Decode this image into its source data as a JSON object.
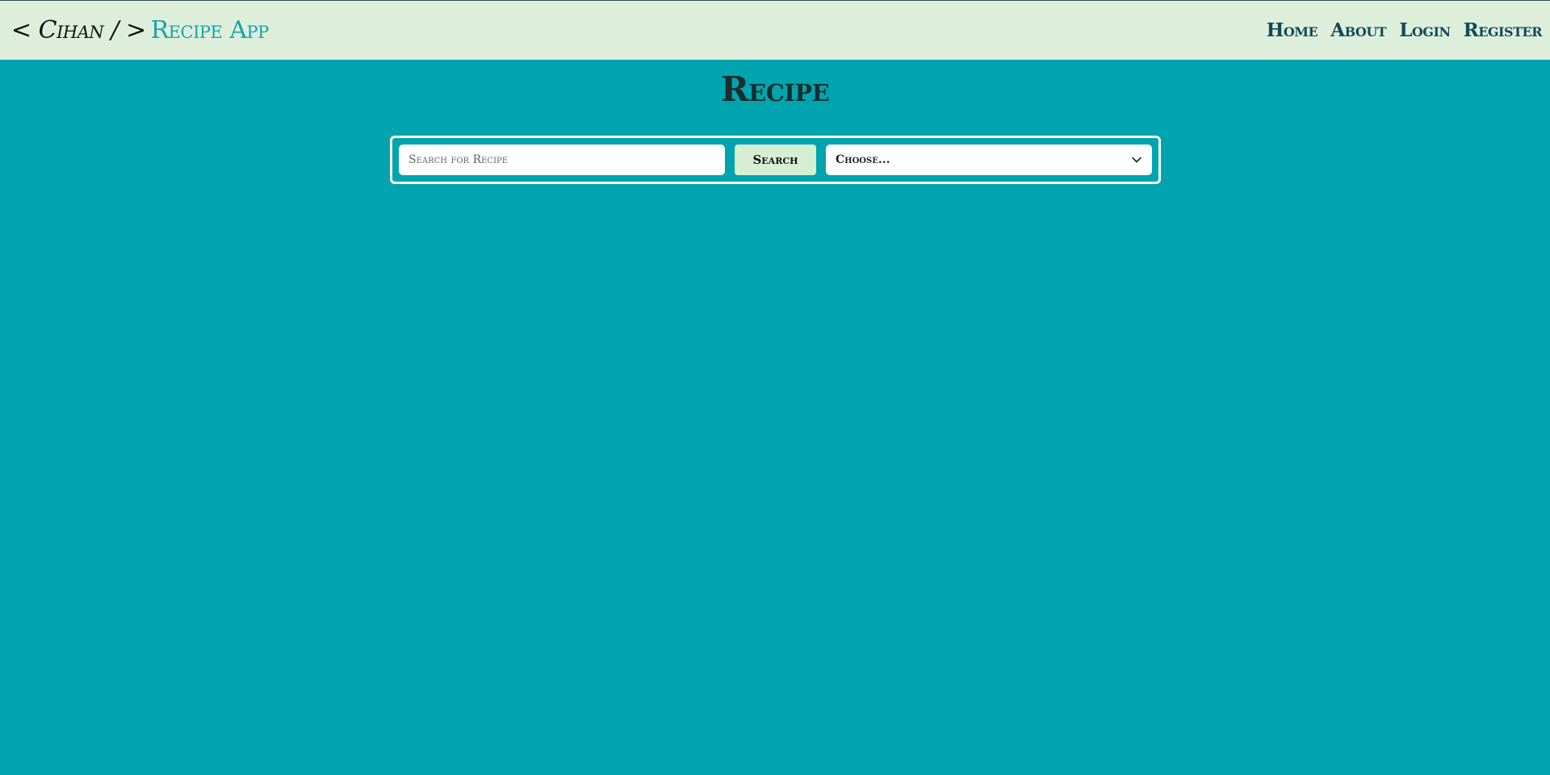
{
  "navbar": {
    "brand_owner": "< Cihan / >",
    "brand_app": "Recipe App",
    "links": [
      {
        "label": "Home"
      },
      {
        "label": "About"
      },
      {
        "label": "Login"
      },
      {
        "label": "Register"
      }
    ]
  },
  "main": {
    "title": "Recipe",
    "search": {
      "placeholder": "Search for Recipe",
      "value": "",
      "button_label": "Search",
      "select_value": "Choose..."
    }
  },
  "colors": {
    "page_background": "#00A4AE",
    "navbar_background": "#DDEFDA",
    "brand_accent": "#17A3AD",
    "nav_link": "#114A5C",
    "button_background": "#D6EFD3"
  },
  "icons": {
    "select_arrow": "chevron-down-icon"
  }
}
